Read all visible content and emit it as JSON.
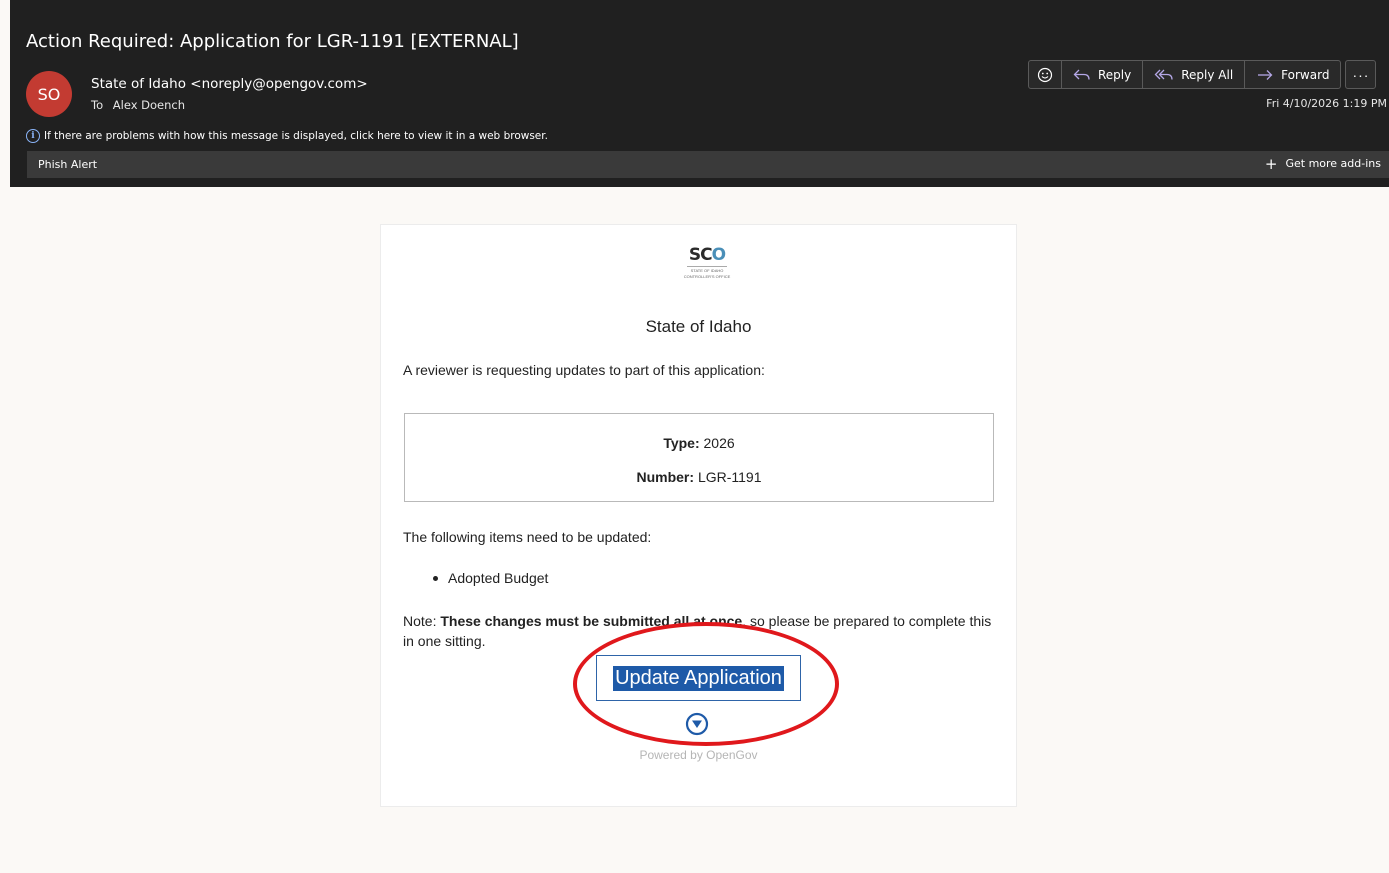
{
  "email": {
    "subject": "Action Required: Application for LGR-1191  [EXTERNAL]",
    "avatar_initials": "SO",
    "avatar_color": "#c33b32",
    "sender": "State of Idaho <noreply@opengov.com>",
    "to_label": "To",
    "to_name": "Alex Doench",
    "info_message": "If there are problems with how this message is displayed, click here to view it in a web browser.",
    "date": "Fri 4/10/2026 1:19 PM"
  },
  "toolbar": {
    "reply_label": "Reply",
    "reply_all_label": "Reply All",
    "forward_label": "Forward",
    "more_label": "···"
  },
  "addins": {
    "phish_alert": "Phish Alert",
    "get_more": "Get more add-ins"
  },
  "body": {
    "logo_text": "SCO",
    "logo_sub_1": "STATE OF IDAHO",
    "logo_sub_2": "CONTROLLER'S OFFICE",
    "org_name": "State of Idaho",
    "intro": "A reviewer is requesting updates to part of this application:",
    "type_label": "Type:",
    "type_value": "2026",
    "number_label": "Number:",
    "number_value": "LGR-1191",
    "items_intro": "The following items need to be updated:",
    "items": [
      "Adopted Budget"
    ],
    "note_prefix": "Note: ",
    "note_bold": "These changes must be submitted all at once",
    "note_suffix": ", so please be prepared to complete this in one sitting.",
    "button_label": "Update Application",
    "powered_by": "Powered by OpenGov",
    "accent_color": "#1e5aa8",
    "annotation_color": "#e0181c"
  }
}
